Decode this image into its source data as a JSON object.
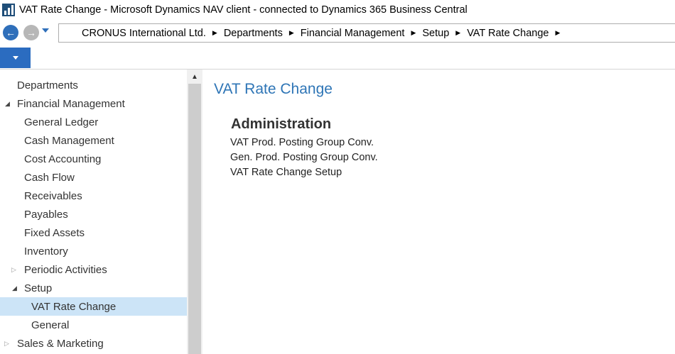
{
  "window": {
    "title": "VAT Rate Change - Microsoft Dynamics NAV client - connected to Dynamics 365 Business Central"
  },
  "nav": {
    "back_icon": "arrow-left-icon",
    "forward_icon": "arrow-right-icon",
    "history_icon": "chevron-down-icon"
  },
  "breadcrumb": [
    "CRONUS International Ltd.",
    "Departments",
    "Financial Management",
    "Setup",
    "VAT Rate Change"
  ],
  "colors": {
    "accent": "#2b6cc0",
    "title_blue": "#2e75b6",
    "selected_bg": "#cce4f7"
  },
  "sidebar": {
    "items": [
      {
        "label": "Departments",
        "level": 0,
        "expander": "none"
      },
      {
        "label": "Financial Management",
        "level": 0,
        "expander": "open"
      },
      {
        "label": "General Ledger",
        "level": 1,
        "expander": "none"
      },
      {
        "label": "Cash Management",
        "level": 1,
        "expander": "none"
      },
      {
        "label": "Cost Accounting",
        "level": 1,
        "expander": "none"
      },
      {
        "label": "Cash Flow",
        "level": 1,
        "expander": "none"
      },
      {
        "label": "Receivables",
        "level": 1,
        "expander": "none"
      },
      {
        "label": "Payables",
        "level": 1,
        "expander": "none"
      },
      {
        "label": "Fixed Assets",
        "level": 1,
        "expander": "none"
      },
      {
        "label": "Inventory",
        "level": 1,
        "expander": "none"
      },
      {
        "label": "Periodic Activities",
        "level": 1,
        "expander": "closed"
      },
      {
        "label": "Setup",
        "level": 1,
        "expander": "open"
      },
      {
        "label": "VAT Rate Change",
        "level": 2,
        "expander": "none",
        "selected": true
      },
      {
        "label": "General",
        "level": 2,
        "expander": "none"
      },
      {
        "label": "Sales & Marketing",
        "level": 0,
        "expander": "closed"
      }
    ]
  },
  "main": {
    "title": "VAT Rate Change",
    "sections": [
      {
        "heading": "Administration",
        "links": [
          "VAT Prod. Posting Group Conv.",
          "Gen. Prod. Posting Group Conv.",
          "VAT Rate Change Setup"
        ]
      }
    ]
  }
}
